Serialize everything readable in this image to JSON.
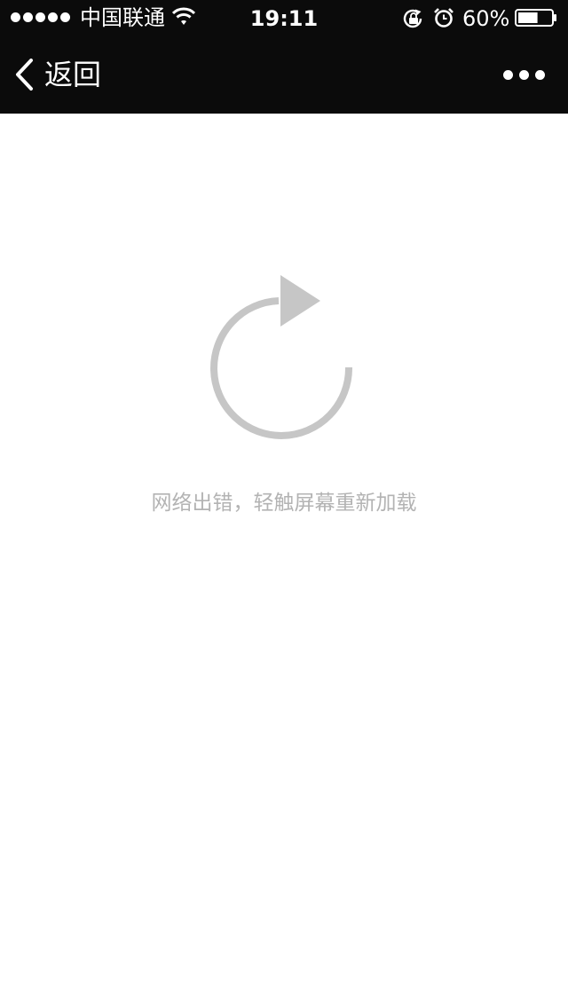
{
  "status_bar": {
    "carrier": "中国联通",
    "time": "19:11",
    "battery_percent": "60%",
    "battery_level": 0.6,
    "icons": [
      "signal-dots",
      "wifi-icon",
      "rotation-lock-icon",
      "alarm-icon",
      "battery-icon"
    ]
  },
  "nav": {
    "back_label": "返回",
    "back_icon": "chevron-left-icon",
    "more_icon": "more-dots-icon"
  },
  "content": {
    "reload_icon": "reload-icon",
    "error_message": "网络出错，轻触屏幕重新加载"
  },
  "colors": {
    "bar_background": "#0b0b0b",
    "icon_gray": "#c6c6c6",
    "text_gray": "#b3b3b3"
  }
}
